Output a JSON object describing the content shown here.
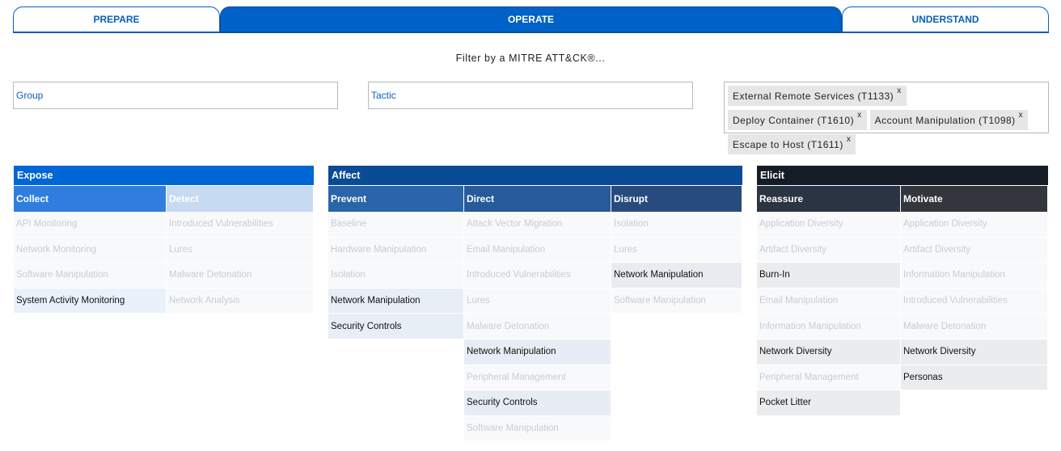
{
  "tabs": [
    {
      "label": "PREPARE",
      "active": false
    },
    {
      "label": "OPERATE",
      "active": true
    },
    {
      "label": "UNDERSTAND",
      "active": false
    }
  ],
  "filter": {
    "caption": "Filter by a MITRE ATT&CK®...",
    "group_placeholder": "Group",
    "tactic_placeholder": "Tactic",
    "techniques": [
      {
        "label": "External Remote Services (T1133)",
        "remove": "x"
      },
      {
        "label": "Deploy Container (T1610)",
        "remove": "x"
      },
      {
        "label": "Account Manipulation (T1098)",
        "remove": "x"
      },
      {
        "label": "Escape to Host (T1611)",
        "remove": "x"
      }
    ]
  },
  "matrix": {
    "expose": {
      "title": "Expose",
      "color": "#0066d6",
      "columns": [
        {
          "header": "Collect",
          "cells": [
            {
              "label": "API Monitoring",
              "active": false
            },
            {
              "label": "Network Monitoring",
              "active": false
            },
            {
              "label": "Software Manipulation",
              "active": false
            },
            {
              "label": "System Activity Monitoring",
              "active": true
            }
          ]
        },
        {
          "header": "Detect",
          "cells": [
            {
              "label": "Introduced Vulnerabilities",
              "active": false
            },
            {
              "label": "Lures",
              "active": false
            },
            {
              "label": "Malware Detonation",
              "active": false
            },
            {
              "label": "Network Analysis",
              "active": false
            }
          ]
        }
      ]
    },
    "affect": {
      "title": "Affect",
      "color": "#0a4b96",
      "columns": [
        {
          "header": "Prevent",
          "cells": [
            {
              "label": "Baseline",
              "active": false
            },
            {
              "label": "Hardware Manipulation",
              "active": false
            },
            {
              "label": "Isolation",
              "active": false
            },
            {
              "label": "Network Manipulation",
              "active": true
            },
            {
              "label": "Security Controls",
              "active": true
            }
          ]
        },
        {
          "header": "Direct",
          "cells": [
            {
              "label": "Attack Vector Migration",
              "active": false
            },
            {
              "label": "Email Manipulation",
              "active": false
            },
            {
              "label": "Introduced Vulnerabilities",
              "active": false
            },
            {
              "label": "Lures",
              "active": false
            },
            {
              "label": "Malware Detonation",
              "active": false
            },
            {
              "label": "Network Manipulation",
              "active": true
            },
            {
              "label": "Peripheral Management",
              "active": false
            },
            {
              "label": "Security Controls",
              "active": true
            },
            {
              "label": "Software Manipulation",
              "active": false
            }
          ]
        },
        {
          "header": "Disrupt",
          "cells": [
            {
              "label": "Isolation",
              "active": false
            },
            {
              "label": "Lures",
              "active": false
            },
            {
              "label": "Network Manipulation",
              "active": true
            },
            {
              "label": "Software Manipulation",
              "active": false
            }
          ]
        }
      ]
    },
    "elicit": {
      "title": "Elicit",
      "color": "#151c25",
      "columns": [
        {
          "header": "Reassure",
          "cells": [
            {
              "label": "Application Diversity",
              "active": false
            },
            {
              "label": "Artifact Diversity",
              "active": false
            },
            {
              "label": "Burn-In",
              "active": true
            },
            {
              "label": "Email Manipulation",
              "active": false
            },
            {
              "label": "Information Manipulation",
              "active": false
            },
            {
              "label": "Network Diversity",
              "active": true
            },
            {
              "label": "Peripheral Management",
              "active": false
            },
            {
              "label": "Pocket Litter",
              "active": true
            }
          ]
        },
        {
          "header": "Motivate",
          "cells": [
            {
              "label": "Application Diversity",
              "active": false
            },
            {
              "label": "Artifact Diversity",
              "active": false
            },
            {
              "label": "Information Manipulation",
              "active": false
            },
            {
              "label": "Introduced Vulnerabilities",
              "active": false
            },
            {
              "label": "Malware Detonation",
              "active": false
            },
            {
              "label": "Network Diversity",
              "active": true
            },
            {
              "label": "Personas",
              "active": true
            }
          ]
        }
      ]
    }
  }
}
